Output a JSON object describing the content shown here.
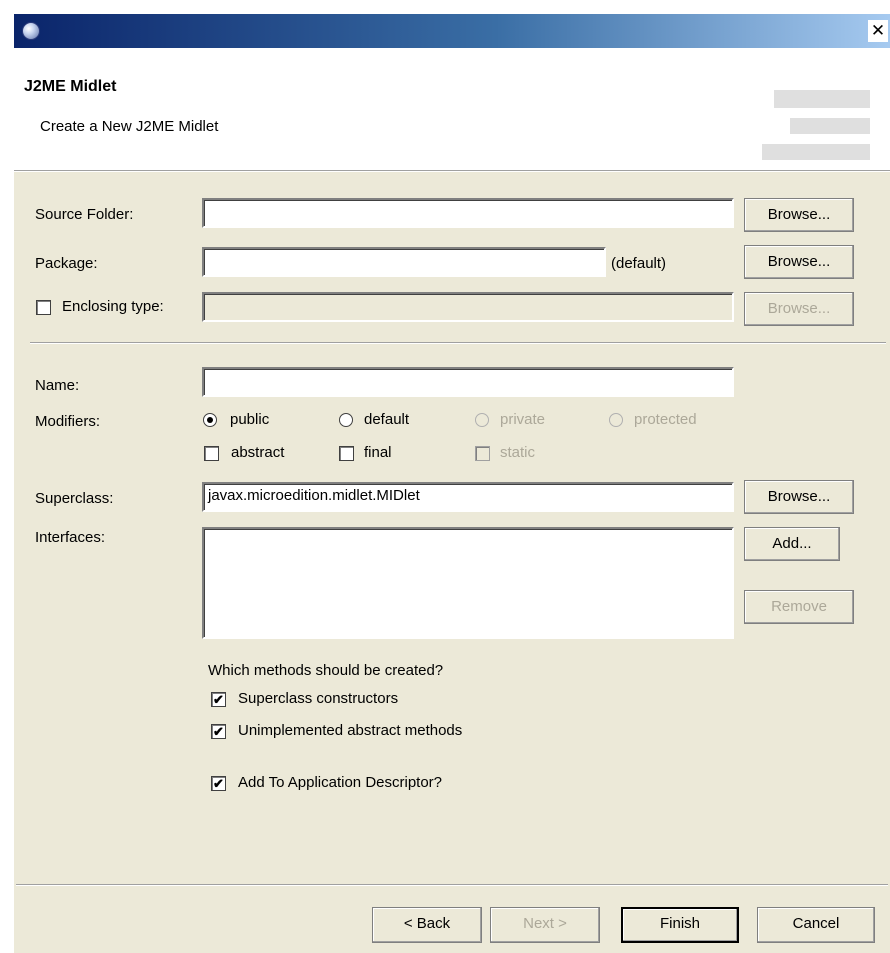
{
  "window": {
    "close_symbol": "✕",
    "banner_title": "J2ME Midlet",
    "banner_description": "Create a New J2ME Midlet"
  },
  "form": {
    "source_folder_label": "Source Folder:",
    "source_folder_value": "",
    "package_label": "Package:",
    "package_value": "",
    "package_default_hint": "(default)",
    "enclosing_type_label": "Enclosing type:",
    "enclosing_type_checked": false,
    "enclosing_type_value": "",
    "browse_label": "Browse...",
    "name_label": "Name:",
    "name_value": "",
    "modifiers_label": "Modifiers:",
    "modifiers": {
      "public": "public",
      "default": "default",
      "private": "private",
      "protected": "protected",
      "abstract": "abstract",
      "final": "final",
      "static": "static",
      "selected_access": "public"
    },
    "superclass_label": "Superclass:",
    "superclass_value": "javax.microedition.midlet.MIDlet",
    "interfaces_label": "Interfaces:",
    "add_label": "Add...",
    "remove_label": "Remove",
    "methods_question": "Which methods should be created?",
    "superclass_constructors_label": "Superclass constructors",
    "superclass_constructors_checked": true,
    "unimplemented_methods_label": "Unimplemented abstract methods",
    "unimplemented_methods_checked": true,
    "add_to_descriptor_label": "Add To Application Descriptor?",
    "add_to_descriptor_checked": true
  },
  "footer": {
    "back_label": "< Back",
    "next_label": "Next >",
    "finish_label": "Finish",
    "cancel_label": "Cancel"
  },
  "glyphs": {
    "check": "✔"
  },
  "colors": {
    "titlebar_start": "#0a246a",
    "titlebar_end": "#a6caf0",
    "dialog_background": "#ece9d8",
    "disabled_text": "#aca899"
  }
}
